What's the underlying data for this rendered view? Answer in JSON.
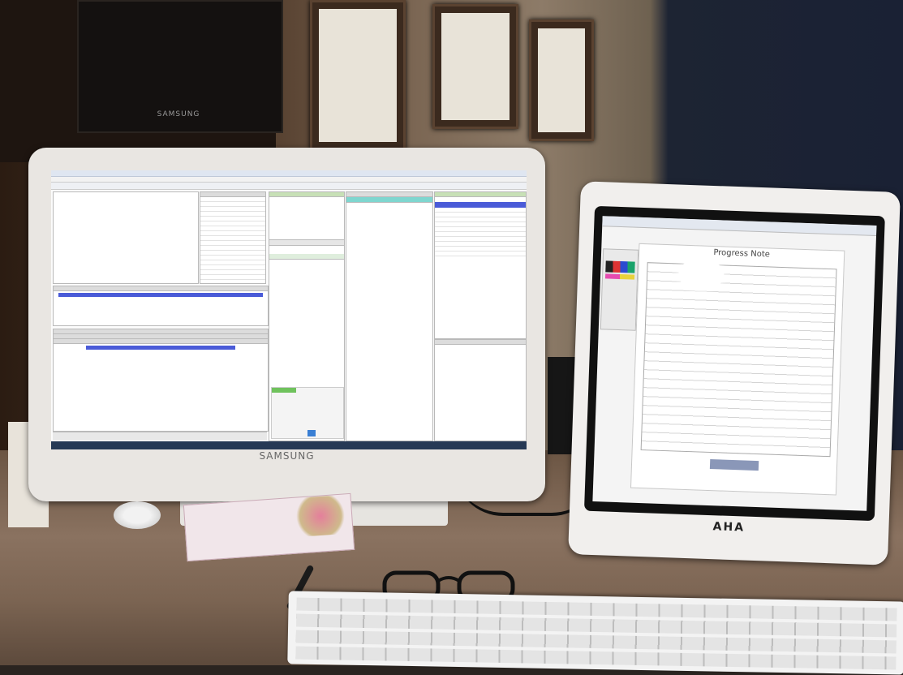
{
  "scene": {
    "monitor_brand": "SAMSUNG",
    "background_monitor_brand": "SAMSUNG",
    "tablet_brand": "AHA",
    "tablet_document_title": "Progress Note"
  },
  "colors": {
    "wall_dark": "#2b1c12",
    "wall_blue": "#1a2134",
    "desk": "#7b6452",
    "monitor_body": "#e9e6e2",
    "screen": "#fbfbfb",
    "selection_blue": "#4a5bd8",
    "accent_teal": "#7fd6cf",
    "taskbar": "#263955"
  }
}
